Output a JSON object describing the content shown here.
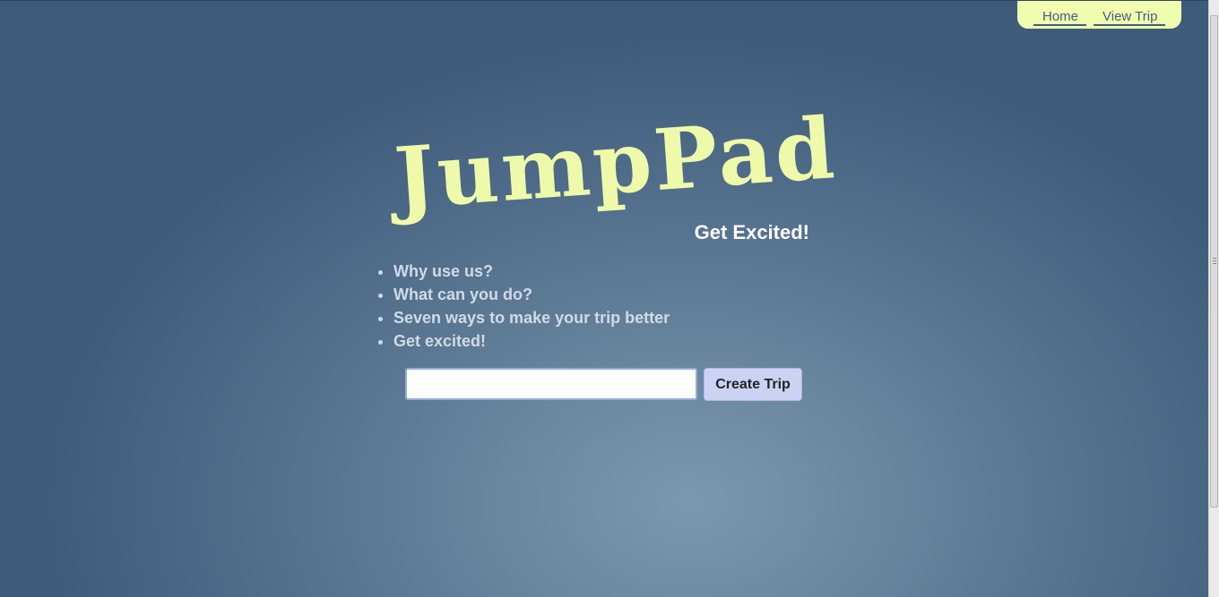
{
  "nav": {
    "home_label": "Home",
    "view_trip_label": "View Trip"
  },
  "hero": {
    "logo": "JumpPad",
    "tagline": "Get Excited!"
  },
  "features": [
    "Why use us?",
    "What can you do?",
    "Seven ways to make your trip better",
    "Get excited!"
  ],
  "trip_form": {
    "input_value": "",
    "button_label": "Create Trip"
  },
  "colors": {
    "background": "#4a6785",
    "nav_background": "#f0fdae",
    "logo": "#eefaa9",
    "button": "#ccd2f4"
  }
}
